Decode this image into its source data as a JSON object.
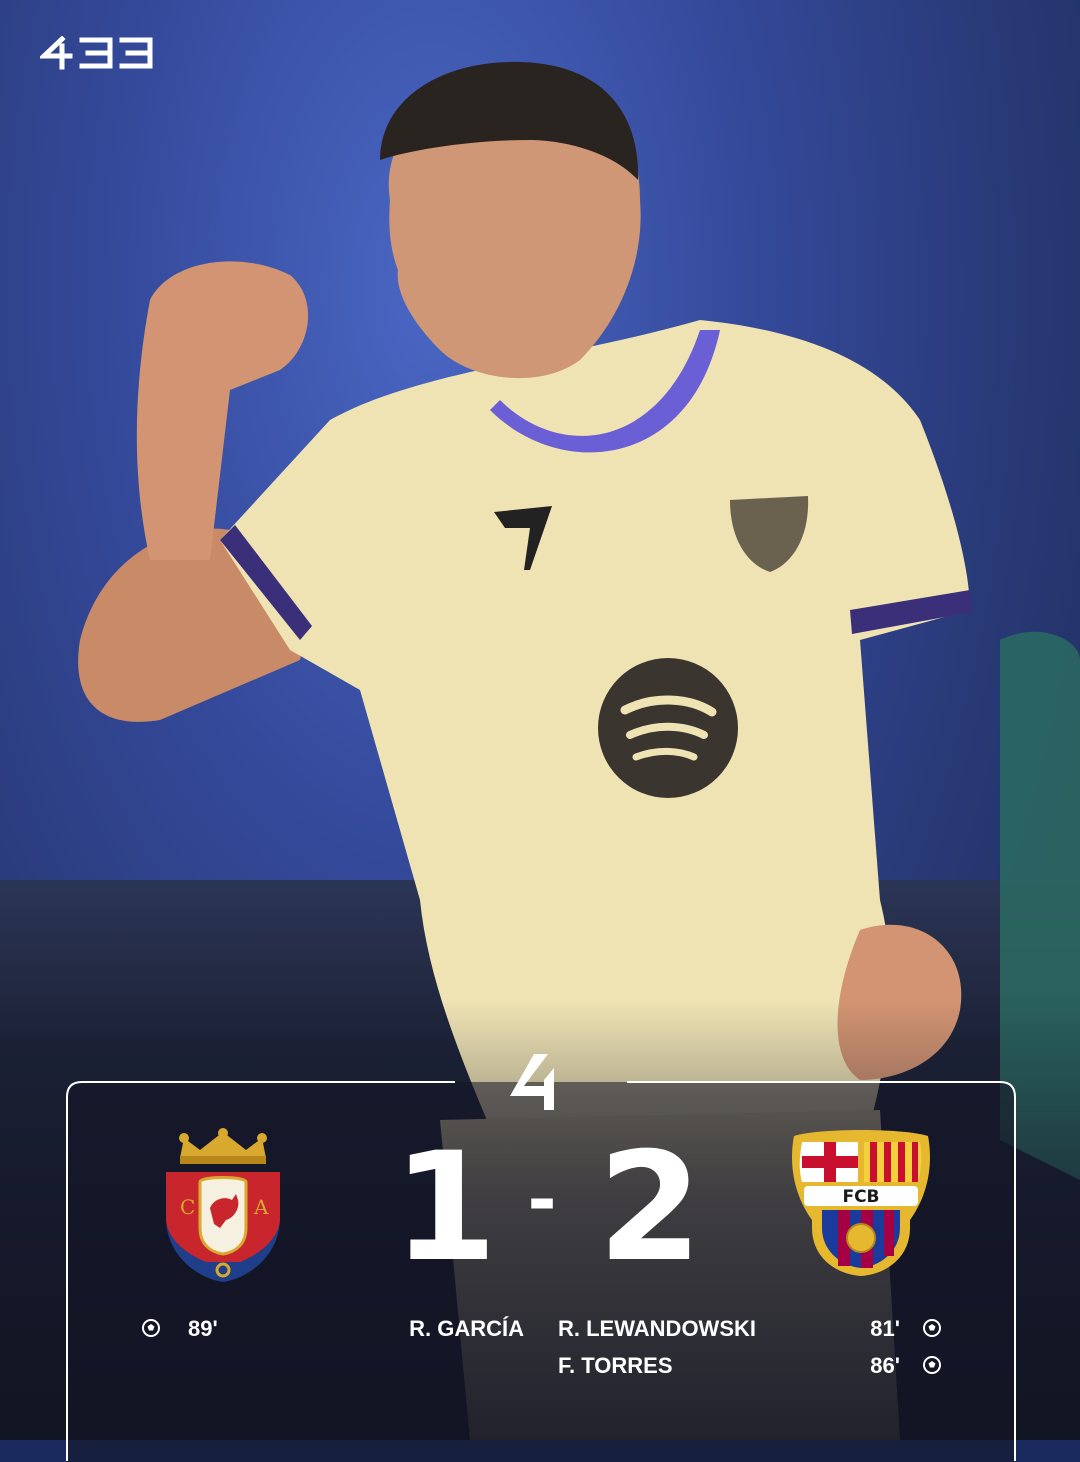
{
  "brand": {
    "logo_text": "433"
  },
  "competition": {
    "logo": "laliga-icon"
  },
  "match": {
    "home": {
      "crest": "osasuna-crest",
      "score": "1"
    },
    "away": {
      "crest": "barcelona-crest",
      "score": "2",
      "crest_text": "FCB"
    },
    "separator": "-"
  },
  "goals": {
    "home": [
      {
        "player": "R. GARCÍA",
        "minute": "89'"
      }
    ],
    "away": [
      {
        "player": "R. LEWANDOWSKI",
        "minute": "81'"
      },
      {
        "player": "F. TORRES",
        "minute": "86'"
      }
    ]
  },
  "colors": {
    "background_blue": "#34499a",
    "jersey": "#efe3b4",
    "card_bg": "#141626",
    "text": "#ffffff"
  }
}
